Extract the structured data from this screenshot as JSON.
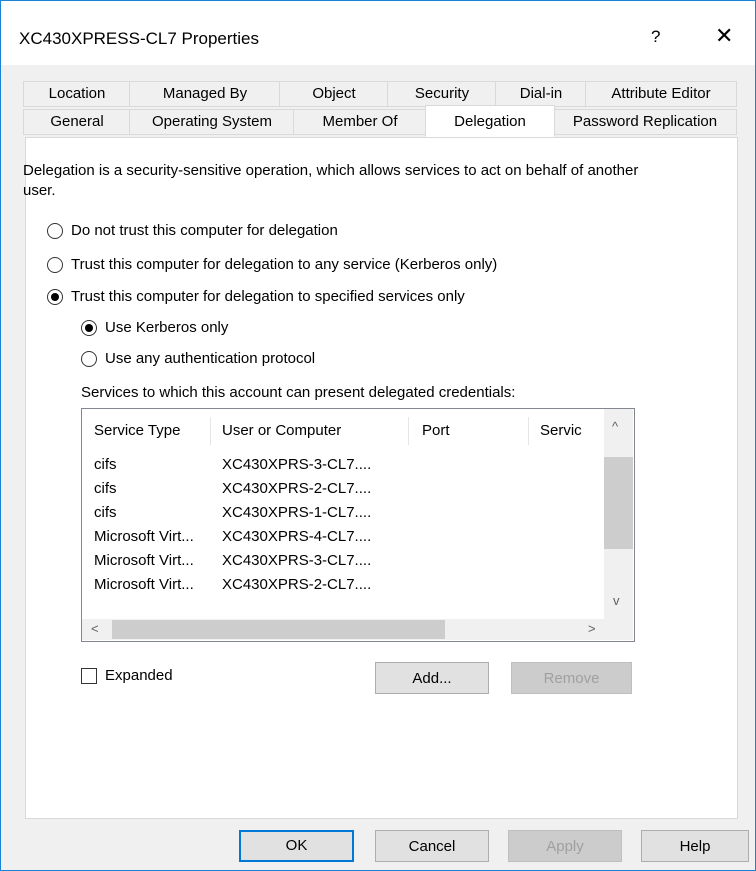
{
  "window": {
    "title": "XC430XPRESS-CL7 Properties",
    "help_glyph": "?",
    "close_glyph": "✕"
  },
  "tabs": {
    "row_top": [
      "Location",
      "Managed By",
      "Object",
      "Security",
      "Dial-in",
      "Attribute Editor"
    ],
    "row_bottom": [
      "General",
      "Operating System",
      "Member Of",
      "Delegation",
      "Password Replication"
    ],
    "selected": "Delegation"
  },
  "delegation": {
    "intro": "Delegation is a security-sensitive operation, which allows services to act on behalf of another user.",
    "options": [
      {
        "label": "Do not trust this computer for delegation",
        "checked": false
      },
      {
        "label": "Trust this computer for delegation to any service (Kerberos only)",
        "checked": false
      },
      {
        "label": "Trust this computer for delegation to specified services only",
        "checked": true
      }
    ],
    "protocol_options": [
      {
        "label": "Use Kerberos only",
        "checked": true
      },
      {
        "label": "Use any authentication protocol",
        "checked": false
      }
    ],
    "services_caption": "Services to which this account can present delegated credentials:",
    "columns": [
      "Service Type",
      "User or Computer",
      "Port",
      "Servic"
    ],
    "rows": [
      [
        "cifs",
        "XC430XPRS-3-CL7....",
        "",
        ""
      ],
      [
        "cifs",
        "XC430XPRS-2-CL7....",
        "",
        ""
      ],
      [
        "cifs",
        "XC430XPRS-1-CL7....",
        "",
        ""
      ],
      [
        "Microsoft Virt...",
        "XC430XPRS-4-CL7....",
        "",
        ""
      ],
      [
        "Microsoft Virt...",
        "XC430XPRS-3-CL7....",
        "",
        ""
      ],
      [
        "Microsoft Virt...",
        "XC430XPRS-2-CL7....",
        "",
        ""
      ]
    ],
    "scroll_glyphs": {
      "up": "^",
      "down": "v",
      "left": "<",
      "right": ">"
    },
    "expanded_label": "Expanded",
    "expanded_checked": false,
    "add_label": "Add...",
    "remove_label": "Remove"
  },
  "footer": {
    "ok": "OK",
    "cancel": "Cancel",
    "apply": "Apply",
    "help": "Help"
  },
  "colors": {
    "accent": "#0078d7",
    "window_border": "#1883d7",
    "dialog_bg": "#f0f0f0"
  }
}
